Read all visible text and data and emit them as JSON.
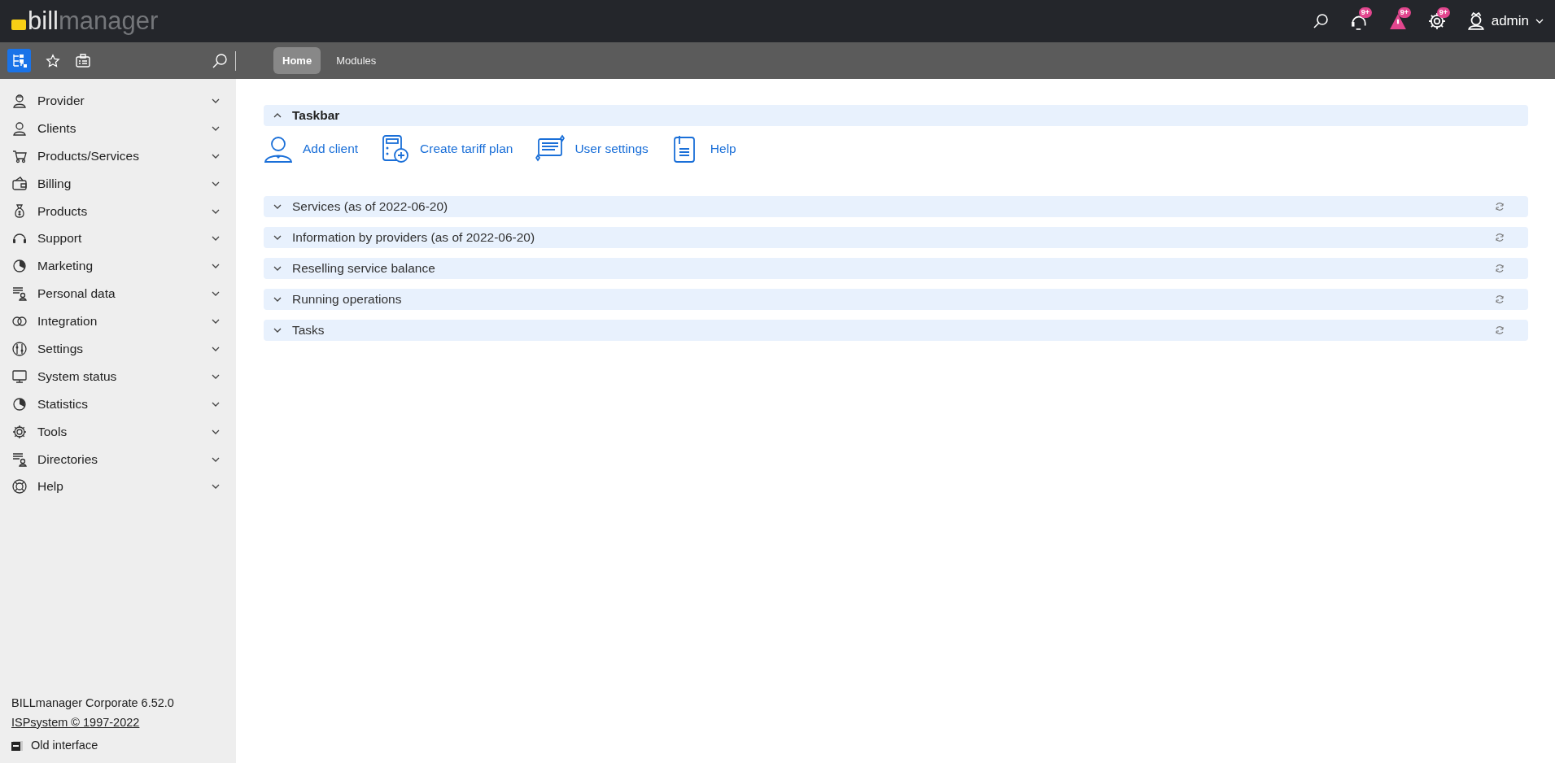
{
  "header": {
    "logo": {
      "part_1": "bill",
      "part_2": "manager"
    },
    "badges": [
      "9+",
      "9+",
      "9+"
    ],
    "user": {
      "name": "admin"
    }
  },
  "toolbar": {
    "tabs": [
      {
        "label": "Home",
        "selected": true
      },
      {
        "label": "Modules",
        "selected": false
      }
    ]
  },
  "sidebar": {
    "items": [
      {
        "label": "Provider",
        "expanded": false
      },
      {
        "label": "Clients",
        "expanded": false
      },
      {
        "label": "Products/Services",
        "expanded": false
      },
      {
        "label": "Billing",
        "expanded": false
      },
      {
        "label": "Products",
        "expanded": false
      },
      {
        "label": "Support",
        "expanded": false
      },
      {
        "label": "Marketing",
        "expanded": false
      },
      {
        "label": "Personal data",
        "expanded": false
      },
      {
        "label": "Integration",
        "expanded": false
      },
      {
        "label": "Settings",
        "expanded": false
      },
      {
        "label": "System status",
        "expanded": false
      },
      {
        "label": "Statistics",
        "expanded": false
      },
      {
        "label": "Tools",
        "expanded": false
      },
      {
        "label": "Directories",
        "expanded": false
      },
      {
        "label": "Help",
        "expanded": false
      }
    ],
    "version": "BILLmanager Corporate 6.52.0",
    "copyright_link": "ISPsystem © 1997-2022",
    "old_interface": "Old interface"
  },
  "taskbar": {
    "title": "Taskbar",
    "expanded": true,
    "actions": [
      {
        "label": "Add client"
      },
      {
        "label": "Create tariff plan"
      },
      {
        "label": "User settings"
      },
      {
        "label": "Help"
      }
    ]
  },
  "sections": [
    {
      "title": "Services (as of 2022-06-20)",
      "expanded": false
    },
    {
      "title": "Information by providers (as of 2022-06-20)",
      "expanded": false
    },
    {
      "title": "Reselling service balance",
      "expanded": false
    },
    {
      "title": "Running operations",
      "expanded": false
    },
    {
      "title": "Tasks",
      "expanded": false
    }
  ]
}
